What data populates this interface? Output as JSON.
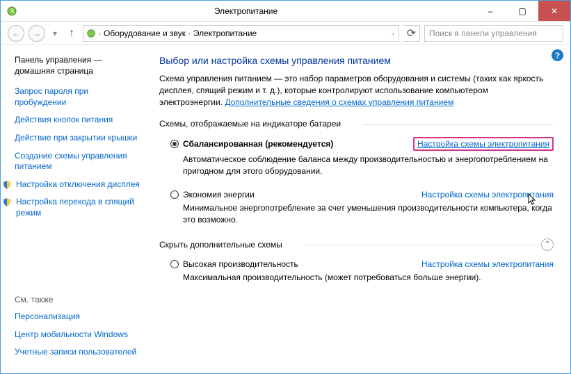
{
  "window": {
    "title": "Электропитание",
    "minimize": "–",
    "maximize": "▢",
    "close": "✕"
  },
  "nav": {
    "back": "←",
    "forward": "→",
    "dropdown": "▾",
    "up": "↑",
    "refresh": "⟳",
    "crumb1": "Оборудование и звук",
    "crumb2": "Электропитание",
    "sep": "›",
    "bc_dropdown": "⌄",
    "search_placeholder": "Поиск в панели управления"
  },
  "sidebar": {
    "home1": "Панель управления —",
    "home2": "домашняя страница",
    "link1": "Запрос пароля при пробуждении",
    "link2": "Действия кнопок питания",
    "link3": "Действие при закрытии крышки",
    "link4": "Создание схемы управления питанием",
    "link5": "Настройка отключения дисплея",
    "link6": "Настройка перехода в спящий режим",
    "see_also": "См. также",
    "pers": "Персонализация",
    "mob": "Центр мобильности Windows",
    "uac": "Учетные записи пользователей"
  },
  "main": {
    "heading": "Выбор или настройка схемы управления питанием",
    "intro_pre": "Схема управления питанием — это набор параметров оборудования и системы (таких как яркость дисплея, спящий режим и т. д.), которые контролируют использование компьютером электроэнергии. ",
    "intro_link": "Дополнительные сведения о схемах управления питанием",
    "group1": "Схемы, отображаемые на индикаторе батареи",
    "plan1_name": "Сбалансированная (рекомендуется)",
    "plan1_link": "Настройка схемы электропитания",
    "plan1_desc": "Автоматическое соблюдение баланса между производительностью и энергопотреблением на пригодном для этого оборудовании.",
    "plan2_name": "Экономия энергии",
    "plan2_link": "Настройка схемы электропитания",
    "plan2_desc": "Минимальное энергопотребление за счет уменьшения производительности компьютера, когда это возможно.",
    "group2": "Скрыть дополнительные схемы",
    "collapse_glyph": "⌃",
    "plan3_name": "Высокая производительность",
    "plan3_link": "Настройка схемы электропитания",
    "plan3_desc": "Максимальная производительность (может потребоваться больше энергии).",
    "help_glyph": "?"
  }
}
